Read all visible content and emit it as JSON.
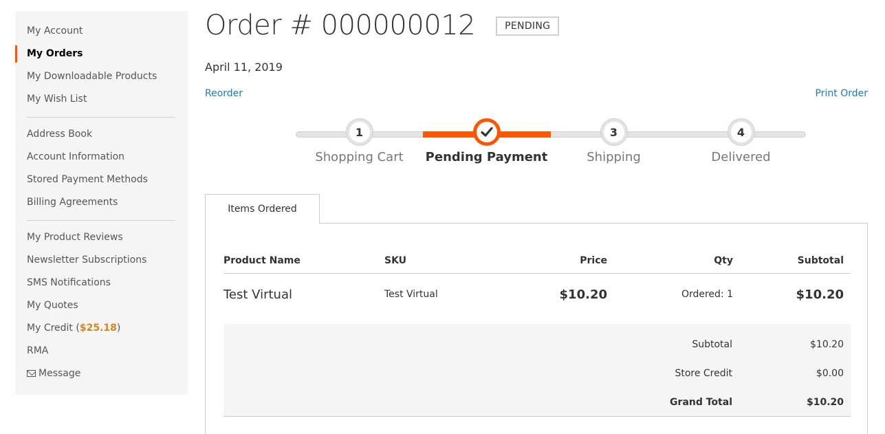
{
  "sidebar": {
    "group1": [
      {
        "label": "My Account"
      },
      {
        "label": "My Orders"
      },
      {
        "label": "My Downloadable Products"
      },
      {
        "label": "My Wish List"
      }
    ],
    "group2": [
      {
        "label": "Address Book"
      },
      {
        "label": "Account Information"
      },
      {
        "label": "Stored Payment Methods"
      },
      {
        "label": "Billing Agreements"
      }
    ],
    "group3": [
      {
        "label": "My Product Reviews"
      },
      {
        "label": "Newsletter Subscriptions"
      },
      {
        "label": "SMS Notifications"
      },
      {
        "label": "My Quotes"
      }
    ],
    "credit_label": "My Credit (",
    "credit_amount": "$25.18",
    "credit_close": ")",
    "rma": "RMA",
    "message": "Message",
    "message_icon": "envelope-icon",
    "active_item": "My Orders",
    "accent_color": "#ff5501"
  },
  "order": {
    "title": "Order # 000000012",
    "status": "PENDING",
    "date": "April 11, 2019",
    "reorder": "Reorder",
    "print": "Print Order"
  },
  "progress": {
    "steps": [
      {
        "marker": "1",
        "label": "Shopping Cart"
      },
      {
        "marker": "check-icon",
        "label": "Pending Payment"
      },
      {
        "marker": "3",
        "label": "Shipping"
      },
      {
        "marker": "4",
        "label": "Delivered"
      }
    ],
    "active_step": "Pending Payment"
  },
  "tabs": {
    "items_ordered": "Items Ordered"
  },
  "table": {
    "headers": {
      "name": "Product Name",
      "sku": "SKU",
      "price": "Price",
      "qty": "Qty",
      "subtotal": "Subtotal"
    },
    "rows": [
      {
        "name": "Test Virtual",
        "sku": "Test Virtual",
        "price": "$10.20",
        "qty": "Ordered: 1",
        "subtotal": "$10.20"
      }
    ]
  },
  "totals": {
    "subtotal_label": "Subtotal",
    "subtotal_value": "$10.20",
    "credit_label": "Store Credit",
    "credit_value": "$0.00",
    "grand_label": "Grand Total",
    "grand_value": "$10.20"
  }
}
